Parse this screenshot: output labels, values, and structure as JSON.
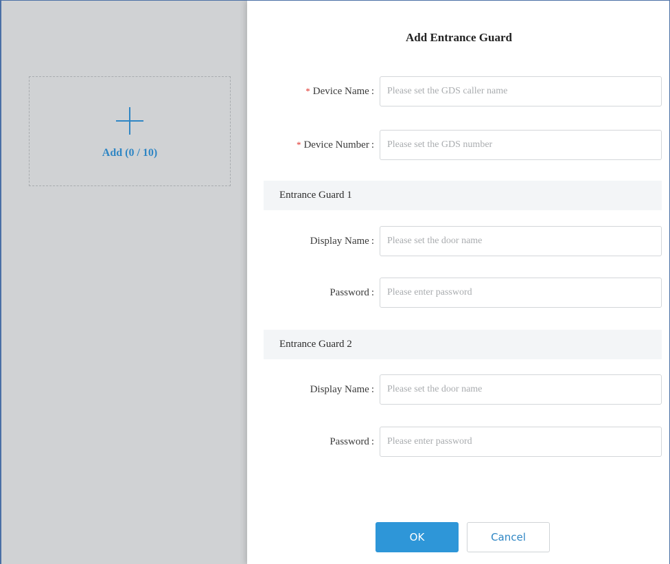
{
  "backdrop": {
    "add_card_label": "Add (0 / 10)",
    "plus_icon": "plus-icon"
  },
  "dialog": {
    "title": "Add Entrance Guard",
    "device_name": {
      "required_mark": "*",
      "label": "Device Name",
      "colon": ":",
      "placeholder": "Please set the GDS caller name"
    },
    "device_number": {
      "required_mark": "*",
      "label": "Device Number",
      "colon": ":",
      "placeholder": "Please set the GDS number"
    },
    "guard1": {
      "title": "Entrance Guard 1",
      "display_name_label": "Display Name",
      "display_name_placeholder": "Please set the door name",
      "password_label": "Password",
      "password_placeholder": "Please enter password",
      "colon": ":"
    },
    "guard2": {
      "title": "Entrance Guard 2",
      "display_name_label": "Display Name",
      "display_name_placeholder": "Please set the door name",
      "password_label": "Password",
      "password_placeholder": "Please enter password",
      "colon": ":"
    },
    "ok_label": "OK",
    "cancel_label": "Cancel"
  },
  "colors": {
    "accent": "#2e96d8",
    "required": "#e0312a",
    "backdrop": "#d0d2d4"
  }
}
